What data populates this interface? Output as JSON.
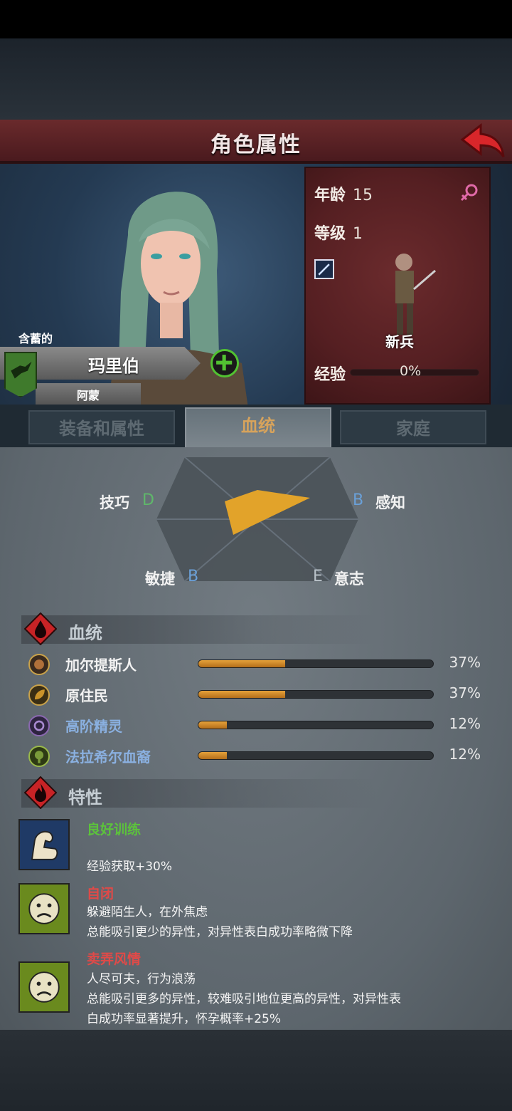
{
  "header": {
    "title": "角色属性"
  },
  "character": {
    "nickname": "含蓄的",
    "name": "玛里伯",
    "family": "阿蒙",
    "age_label": "年龄",
    "age": "15",
    "level_label": "等级",
    "level": "1",
    "class_name": "新兵",
    "exp_label": "经验",
    "exp_value": "0%"
  },
  "tabs": [
    {
      "label": "装备和属性",
      "active": false
    },
    {
      "label": "血统",
      "active": true
    },
    {
      "label": "家庭",
      "active": false
    }
  ],
  "radar": {
    "skill_label": "技巧",
    "skill_grade": "D",
    "perception_label": "感知",
    "perception_grade": "B",
    "agility_label": "敏捷",
    "agility_grade": "B",
    "will_label": "意志",
    "will_grade": "E",
    "grade_colors": {
      "D": "#5fb86a",
      "B": "#6aa0d8",
      "E": "#b9c2c9"
    }
  },
  "lineage": {
    "title": "血统",
    "items": [
      {
        "name": "加尔提斯人",
        "percent": "37%",
        "value": 0.37,
        "color": "#b0703a"
      },
      {
        "name": "原住民",
        "percent": "37%",
        "value": 0.37,
        "color": "#c9922a"
      },
      {
        "name": "高阶精灵",
        "percent": "12%",
        "value": 0.12,
        "color": "#8a68b0"
      },
      {
        "name": "法拉希尔血裔",
        "percent": "12%",
        "value": 0.12,
        "color": "#7a9a3a"
      }
    ]
  },
  "traits": {
    "title": "特性",
    "items": [
      {
        "name": "良好训练",
        "name_color": "#5cc23c",
        "icon": "strong-arm-icon",
        "lines": [
          "",
          "经验获取+30%"
        ]
      },
      {
        "name": "自闭",
        "name_color": "#e04a48",
        "icon": "sad-face-icon",
        "lines": [
          "躲避陌生人，在外焦虑",
          "总能吸引更少的异性，对异性表白成功率略微下降"
        ]
      },
      {
        "name": "卖弄风情",
        "name_color": "#e04a48",
        "icon": "sad-face-icon",
        "lines": [
          "人尽可夫，行为浪荡",
          "总能吸引更多的异性，较难吸引地位更高的异性，对异性表",
          "白成功率显著提升，怀孕概率+25%"
        ]
      }
    ]
  }
}
